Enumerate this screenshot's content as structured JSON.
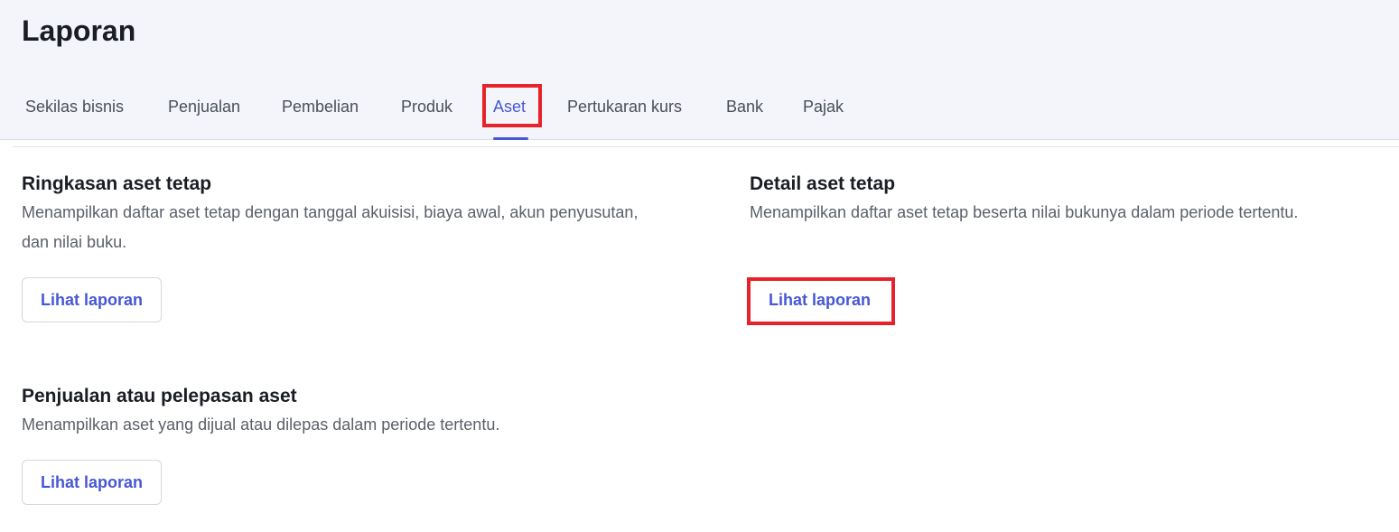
{
  "header": {
    "title": "Laporan",
    "tabs": [
      {
        "label": "Sekilas bisnis"
      },
      {
        "label": "Penjualan"
      },
      {
        "label": "Pembelian"
      },
      {
        "label": "Produk"
      },
      {
        "label": "Aset",
        "active": true
      },
      {
        "label": "Pertukaran kurs"
      },
      {
        "label": "Bank"
      },
      {
        "label": "Pajak"
      }
    ]
  },
  "cards": [
    {
      "title": "Ringkasan aset tetap",
      "description": "Menampilkan daftar aset tetap dengan tanggal akuisisi, biaya awal, akun penyusutan, dan nilai buku.",
      "button_label": "Lihat laporan"
    },
    {
      "title": "Detail aset tetap",
      "description": "Menampilkan daftar aset tetap beserta nilai bukunya dalam periode tertentu.",
      "button_label": "Lihat laporan"
    },
    {
      "title": "Penjualan atau pelepasan aset",
      "description": "Menampilkan aset yang dijual atau dilepas dalam periode tertentu.",
      "button_label": "Lihat laporan"
    }
  ],
  "colors": {
    "accent": "#4657d6",
    "highlight": "#e8222a",
    "header_bg": "#f3f5fa"
  }
}
